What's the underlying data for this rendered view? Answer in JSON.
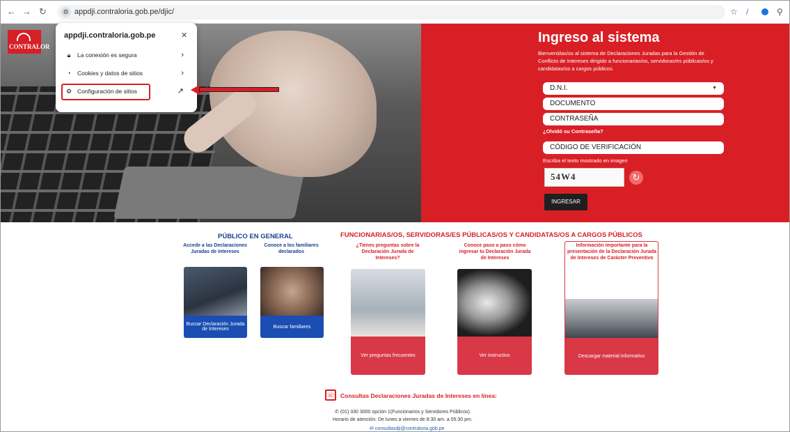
{
  "browser": {
    "url": "appdji.contraloria.gob.pe/djic/",
    "icons": [
      "back-icon",
      "forward-icon",
      "reload-icon",
      "site-info-icon",
      "star-icon",
      "pen-icon",
      "profile-icon",
      "extensions-icon"
    ]
  },
  "logo": {
    "text": "CONTRALOR"
  },
  "popup": {
    "domain": "appdji.contraloria.gob.pe",
    "items": [
      {
        "label": "La conexión es segura",
        "icon": "lock-icon"
      },
      {
        "label": "Cookies y datos de sitios",
        "icon": "cookie-icon"
      },
      {
        "label": "Configuración de sitios",
        "icon": "settings-icon"
      }
    ],
    "highlight_color": "#d81e26"
  },
  "login": {
    "title": "Ingreso al sistema",
    "description": "Bienvenidas/os al sistema de Declaraciones Juradas para la Gestión de Conflicto de Intereses dirigido a funcionarias/os, servidoras/es públicas/os y candidatas/os a cargos públicos.",
    "doc_type": "D.N.I.",
    "doc_placeholder": "DOCUMENTO",
    "password_placeholder": "CONTRASEÑA",
    "forgot": "¿Olvidó su Contraseña?",
    "code_placeholder": "CÓDIGO DE VERIFICACIÓN",
    "hint": "Escriba el texto mostrado en imagen",
    "captcha": "54W4",
    "button": "INGRESAR",
    "bg_color": "#d91f26"
  },
  "public": {
    "title": "PÚBLICO EN GENERAL",
    "cards": [
      {
        "heading": "Accede a las Declaraciones Juradas de Intereses",
        "caption": "Buscar Declaración Jurada de Intereses"
      },
      {
        "heading": "Conoce a los familiares declarados",
        "caption": "Buscar familiares"
      }
    ],
    "color": "#1b3f8f"
  },
  "officials": {
    "title": "FUNCIONARIAS/OS, SERVIDORAS/ES PÚBLICAS/OS Y CANDIDATAS/OS A CARGOS PÚBLICOS",
    "cards": [
      {
        "heading": "¿Tienes preguntas sobre la Declaración Jurada de Intereses?",
        "caption": "Ver preguntas frecuentes"
      },
      {
        "heading": "Conoce paso a paso cómo ingresar tu Declaración Jurada de Intereses",
        "caption": "Ver instructivo"
      },
      {
        "heading": "Información importante para la presentación de la Declaración Jurada de Intereses de Carácter Preventivo",
        "caption": "Descargar material informativo"
      }
    ],
    "color": "#d81e26"
  },
  "footer": {
    "title": "Consultas Declaraciones Juradas de Intereses en línea:",
    "phone": "(01) 330 3000 opción 1(Funcionarios y Servidores Públicos).",
    "hours": "Horario de atención: De lunes a viernes de 8:30 am. a 05:30 pm.",
    "email": "consultasdji@contraloria.gob.pe"
  }
}
